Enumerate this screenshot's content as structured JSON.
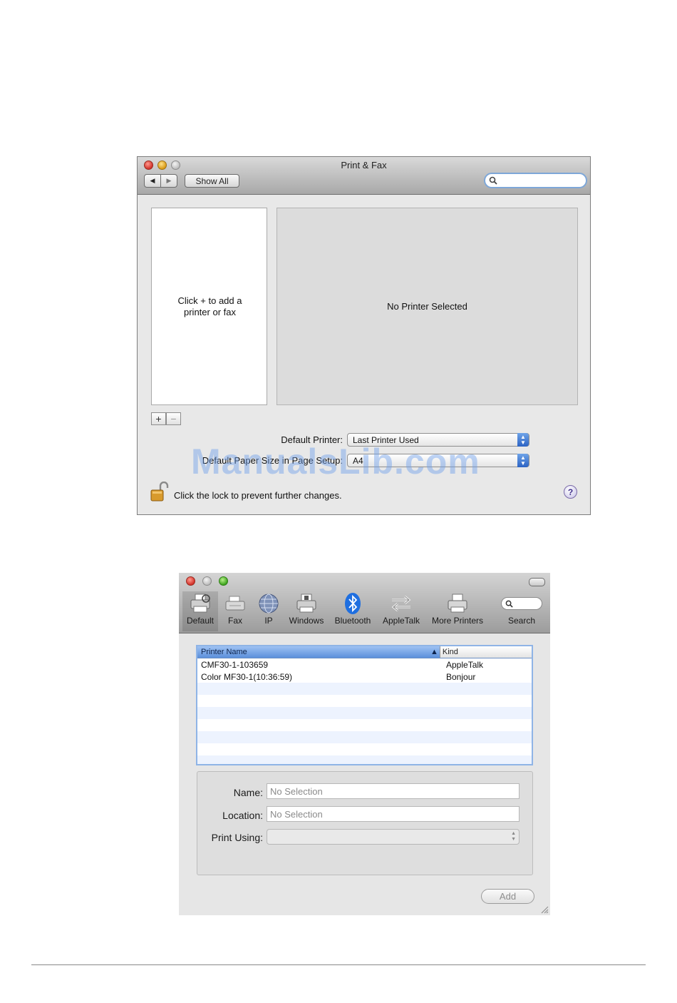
{
  "print_fax": {
    "title": "Print & Fax",
    "show_all": "Show All",
    "search_placeholder": "",
    "printer_list_hint": "Click + to add a printer or fax",
    "no_printer": "No Printer Selected",
    "add_symbol": "+",
    "remove_symbol": "−",
    "default_printer_label": "Default Printer:",
    "default_printer_value": "Last Printer Used",
    "default_paper_label": "Default Paper Size in Page Setup:",
    "default_paper_value": "A4",
    "lock_text": "Click the lock to prevent further changes.",
    "help_symbol": "?",
    "watermark": "ManualsLib.com"
  },
  "add_printer": {
    "toolbar": [
      {
        "label": "Default",
        "icon": "default-printer-icon"
      },
      {
        "label": "Fax",
        "icon": "fax-icon"
      },
      {
        "label": "IP",
        "icon": "ip-globe-icon"
      },
      {
        "label": "Windows",
        "icon": "windows-printer-icon"
      },
      {
        "label": "Bluetooth",
        "icon": "bluetooth-icon"
      },
      {
        "label": "AppleTalk",
        "icon": "appletalk-icon"
      },
      {
        "label": "More Printers",
        "icon": "more-printers-icon"
      },
      {
        "label": "Search",
        "icon": "search-icon"
      }
    ],
    "columns": [
      "Printer Name",
      "Kind"
    ],
    "sort_indicator": "▲",
    "rows": [
      {
        "name": "CMF30-1-103659",
        "kind": "AppleTalk"
      },
      {
        "name": "Color MF30-1(10:36:59)",
        "kind": "Bonjour"
      }
    ],
    "name_label": "Name:",
    "name_value": "No Selection",
    "location_label": "Location:",
    "location_value": "No Selection",
    "print_using_label": "Print Using:",
    "print_using_value": "",
    "add_button": "Add"
  },
  "colors": {
    "selection_blue": "#5b8fdb",
    "focus_ring": "#7ea7d8",
    "alt_row": "#edf3fe"
  }
}
